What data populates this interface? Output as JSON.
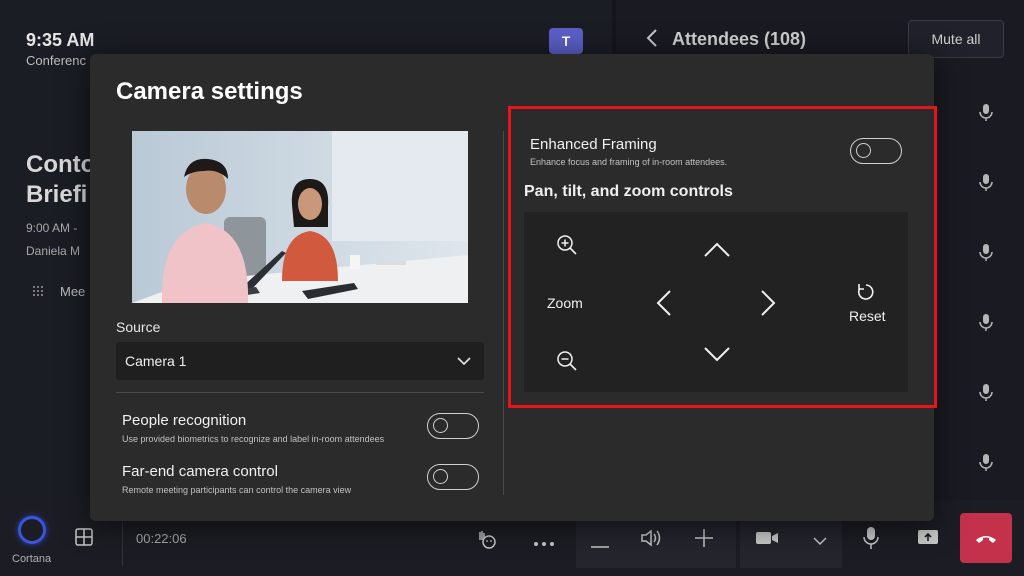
{
  "background": {
    "time": "9:35 AM",
    "subtitle": "Conferenc",
    "meeting_title_line1": "Conto",
    "meeting_title_line2": "Briefi",
    "meeting_time": "9:00 AM -",
    "organizer": "Daniela M",
    "meet_label": "Mee",
    "teams_logo_letter": "T",
    "attendees_title": "Attendees (108)",
    "mute_all_label": "Mute all"
  },
  "bottom_bar": {
    "cortana_label": "Cortana",
    "call_timer": "00:22:06",
    "hangup_color": "#c4314b"
  },
  "dialog": {
    "title": "Camera settings",
    "source_label": "Source",
    "source_value": "Camera 1",
    "people_recognition": {
      "title": "People recognition",
      "desc": "Use provided biometrics to recognize and label in-room attendees"
    },
    "far_end": {
      "title": "Far-end camera control",
      "desc": "Remote meeting participants can control the camera view"
    },
    "enhanced_framing": {
      "title": "Enhanced Framing",
      "desc": "Enhance focus and framing of in-room attendees."
    },
    "ptz": {
      "heading": "Pan, tilt, and zoom controls",
      "zoom_label": "Zoom",
      "reset_label": "Reset"
    }
  },
  "colors": {
    "highlight": "#e8141c",
    "dialog_bg": "#2b2b2b",
    "accent": "#5b5fc7"
  }
}
